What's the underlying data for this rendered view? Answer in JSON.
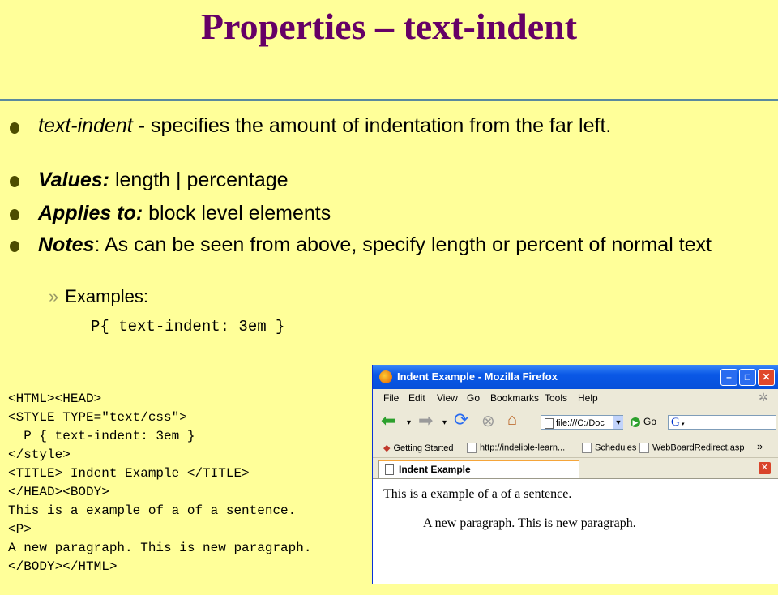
{
  "slide": {
    "title": "Properties – text-indent",
    "bullets": [
      {
        "term": "text-indent",
        "text": " - specifies the amount of indentation from the far left."
      },
      {
        "term": "Values:",
        "text": " length | percentage"
      },
      {
        "term": "Applies to:",
        "text": " block level elements"
      },
      {
        "term": "Notes",
        "text": ": As can be seen from above, specify length or percent of normal text"
      }
    ],
    "sub_bullet": "Examples:",
    "css_example": "P{ text-indent: 3em }",
    "code_lines": [
      "<HTML><HEAD>",
      "<STYLE TYPE=\"text/css\">",
      "  P { text-indent: 3em }",
      "</style>",
      "<TITLE> Indent Example </TITLE>",
      "</HEAD><BODY>",
      "This is a example of a of a sentence.",
      "<P>",
      "A new paragraph. This is new paragraph.",
      "</BODY></HTML>"
    ]
  },
  "browser": {
    "window_title": "Indent Example - Mozilla Firefox",
    "menu": [
      "File",
      "Edit",
      "View",
      "Go",
      "Bookmarks",
      "Tools",
      "Help"
    ],
    "url": "file:///C:/Doc",
    "go_label": "Go",
    "search_logo": "G",
    "bookmarks": [
      "Getting Started",
      "http://indelible-learn...",
      "Schedules",
      "WebBoardRedirect.asp"
    ],
    "bookmarks_more": "»",
    "tab_label": "Indent Example",
    "content": {
      "para1": "This is a example of a of a sentence.",
      "para2": "A new paragraph. This is new paragraph."
    }
  }
}
